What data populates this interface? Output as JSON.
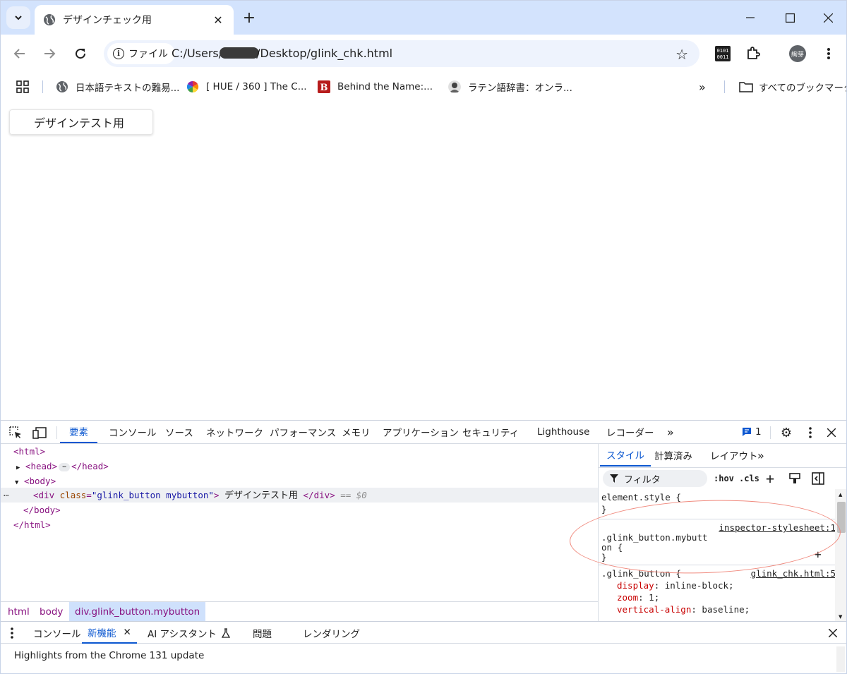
{
  "browser": {
    "tab_title": "デザインチェック用",
    "window_controls": [
      "minimize",
      "maximize",
      "close"
    ]
  },
  "toolbar": {
    "chip_label": "ファイル",
    "url_prefix": "C:/Users/",
    "url_suffix": "/Desktop/glink_chk.html",
    "profile_label": "絢芽"
  },
  "bookmarks": {
    "items": [
      {
        "label": "日本語テキストの難易...",
        "icon": "globe-icon"
      },
      {
        "label": "[ HUE / 360 ] The C...",
        "icon": "color-wheel-icon"
      },
      {
        "label": "Behind the Name:...",
        "icon": "b-logo-icon"
      },
      {
        "label": "ラテン語辞書：オンラ...",
        "icon": "avatar-icon"
      }
    ],
    "all_bookmarks": "すべてのブックマーク"
  },
  "page": {
    "button_label": "デザインテスト用"
  },
  "devtools": {
    "tabs": [
      "要素",
      "コンソール",
      "ソース",
      "ネットワーク",
      "パフォーマンス",
      "メモリ",
      "アプリケーション",
      "セキュリティ",
      "Lighthouse",
      "レコーダー"
    ],
    "issues_count": "1",
    "dom": {
      "html_open": "<html>",
      "head_open": "<head>",
      "head_close": "</head>",
      "body_open": "<body>",
      "div_open_tag": "<div",
      "div_attr_name": "class",
      "div_attr_value": "\"glink_button mybutton\"",
      "div_text": "デザインテスト用",
      "div_close": "</div>",
      "dollar_ref": "== $0",
      "body_close": "</body>",
      "html_close": "</html>"
    },
    "breadcrumb": [
      "html",
      "body",
      "div.glink_button.mybutton"
    ],
    "styles_tabs": [
      "スタイル",
      "計算済み",
      "レイアウト"
    ],
    "filter_placeholder": "フィルタ",
    "hov": ":hov",
    "cls": ".cls",
    "rules": {
      "element_style": "element.style {",
      "close_brace": "}",
      "inspector_source": "inspector-stylesheet:1",
      "selector_line1": ".glink_button.mybutt",
      "selector_line2": "on {",
      "glink_selector": ".glink_button {",
      "glink_source": "glink_chk.html:5",
      "props": [
        {
          "name": "display",
          "value": "inline-block;"
        },
        {
          "name": "zoom",
          "value": "1;"
        },
        {
          "name": "vertical-align",
          "value": "baseline;"
        }
      ]
    },
    "drawer_tabs": [
      "コンソール",
      "新機能",
      "AI アシスタント",
      "問題",
      "レンダリング"
    ],
    "drawer_text": "Highlights from the Chrome 131 update"
  },
  "colors": {
    "accent": "#0b57d0",
    "tabstrip": "#d3e3fd",
    "annotation": "#f08a7e"
  }
}
